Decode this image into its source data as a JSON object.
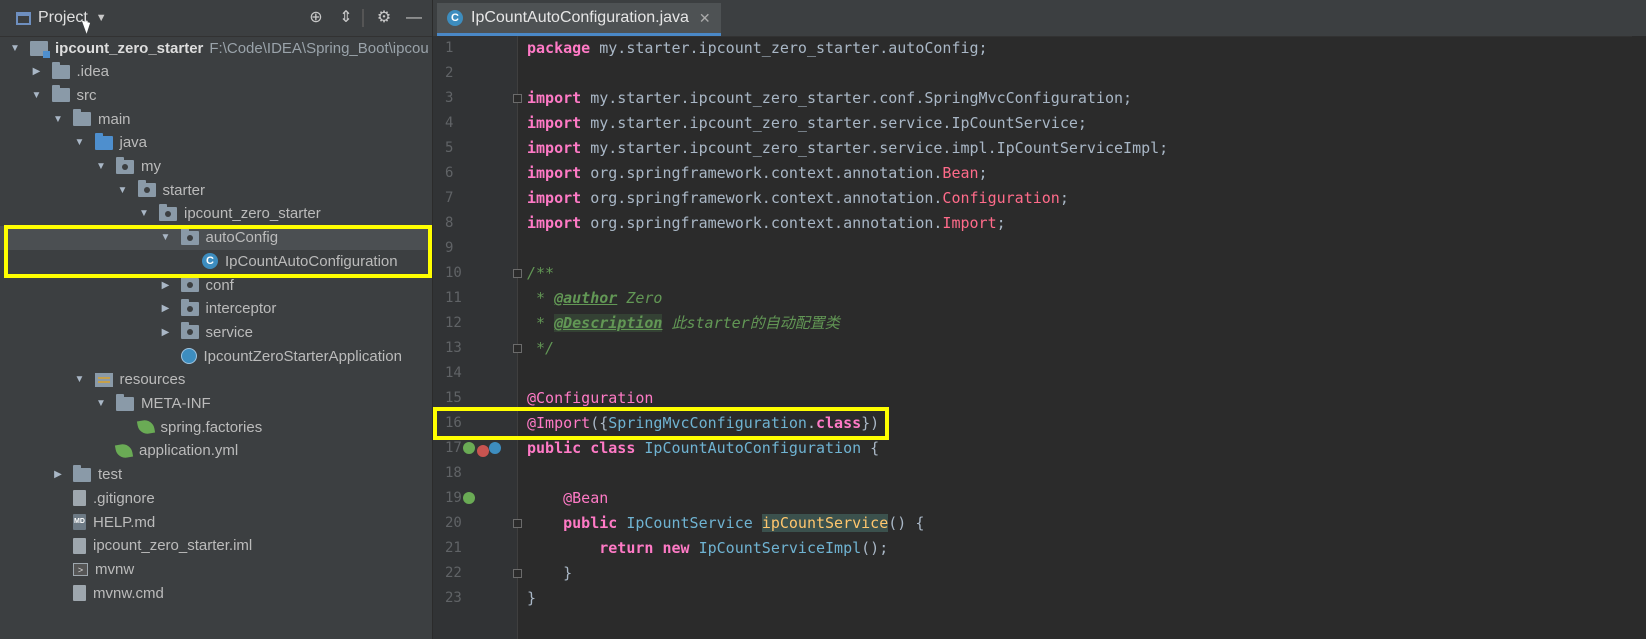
{
  "project": {
    "title": "Project",
    "tree": [
      {
        "label": "ipcount_zero_starter",
        "path": "F:\\Code\\IDEA\\Spring_Boot\\ipcou",
        "icon": "module-icon",
        "arrow": "open",
        "depth": 0,
        "bold": true
      },
      {
        "label": ".idea",
        "icon": "folder-icon",
        "arrow": "closed",
        "depth": 1
      },
      {
        "label": "src",
        "icon": "folder-icon",
        "arrow": "open",
        "depth": 1
      },
      {
        "label": "main",
        "icon": "folder-icon",
        "arrow": "open",
        "depth": 2
      },
      {
        "label": "java",
        "icon": "source-folder-icon",
        "arrow": "open",
        "depth": 3
      },
      {
        "label": "my",
        "icon": "package-icon",
        "arrow": "open",
        "depth": 4
      },
      {
        "label": "starter",
        "icon": "package-icon",
        "arrow": "open",
        "depth": 5
      },
      {
        "label": "ipcount_zero_starter",
        "icon": "package-icon",
        "arrow": "open",
        "depth": 6
      },
      {
        "label": "autoConfig",
        "icon": "package-icon",
        "arrow": "open",
        "depth": 7,
        "selected": true
      },
      {
        "label": "IpCountAutoConfiguration",
        "icon": "class-icon",
        "arrow": "none",
        "depth": 8
      },
      {
        "label": "conf",
        "icon": "package-icon",
        "arrow": "closed",
        "depth": 7
      },
      {
        "label": "interceptor",
        "icon": "package-icon",
        "arrow": "closed",
        "depth": 7
      },
      {
        "label": "service",
        "icon": "package-icon",
        "arrow": "closed",
        "depth": 7
      },
      {
        "label": "IpcountZeroStarterApplication",
        "icon": "spring-app-icon",
        "arrow": "none",
        "depth": 7
      },
      {
        "label": "resources",
        "icon": "resources-folder-icon",
        "arrow": "open",
        "depth": 3
      },
      {
        "label": "META-INF",
        "icon": "folder-icon",
        "arrow": "open",
        "depth": 4
      },
      {
        "label": "spring.factories",
        "icon": "spring-leaf-icon",
        "arrow": "none",
        "depth": 5
      },
      {
        "label": "application.yml",
        "icon": "spring-yml-icon",
        "arrow": "none",
        "depth": 4
      },
      {
        "label": "test",
        "icon": "folder-icon",
        "arrow": "closed",
        "depth": 2
      },
      {
        "label": ".gitignore",
        "icon": "file-icon",
        "arrow": "none",
        "depth": 2
      },
      {
        "label": "HELP.md",
        "icon": "markdown-file-icon",
        "arrow": "none",
        "depth": 2
      },
      {
        "label": "ipcount_zero_starter.iml",
        "icon": "file-icon",
        "arrow": "none",
        "depth": 2
      },
      {
        "label": "mvnw",
        "icon": "terminal-file-icon",
        "arrow": "none",
        "depth": 2
      },
      {
        "label": "mvnw.cmd",
        "icon": "file-icon",
        "arrow": "none",
        "depth": 2
      }
    ]
  },
  "editor": {
    "tab_label": "IpCountAutoConfiguration.java",
    "tab_icon_letter": "C",
    "line_numbers": [
      "1",
      "2",
      "3",
      "4",
      "5",
      "6",
      "7",
      "8",
      "9",
      "10",
      "11",
      "12",
      "13",
      "14",
      "15",
      "16",
      "17",
      "18",
      "19",
      "20",
      "21",
      "22",
      "23"
    ],
    "lines": [
      [
        [
          "kw2",
          "package"
        ],
        [
          "t",
          " my.starter.ipcount_zero_starter.autoConfig;"
        ]
      ],
      [],
      [
        [
          "kw2",
          "import"
        ],
        [
          "t",
          " my.starter.ipcount_zero_starter.conf.SpringMvcConfiguration;"
        ]
      ],
      [
        [
          "kw2",
          "import"
        ],
        [
          "t",
          " my.starter.ipcount_zero_starter.service.IpCountService;"
        ]
      ],
      [
        [
          "kw2",
          "import"
        ],
        [
          "t",
          " my.starter.ipcount_zero_starter.service.impl.IpCountServiceImpl;"
        ]
      ],
      [
        [
          "kw2",
          "import"
        ],
        [
          "t",
          " org.springframework.context.annotation."
        ],
        [
          "ref",
          "Bean"
        ],
        [
          "t",
          ";"
        ]
      ],
      [
        [
          "kw2",
          "import"
        ],
        [
          "t",
          " org.springframework.context.annotation."
        ],
        [
          "ref",
          "Configuration"
        ],
        [
          "t",
          ";"
        ]
      ],
      [
        [
          "kw2",
          "import"
        ],
        [
          "t",
          " org.springframework.context.annotation."
        ],
        [
          "ref",
          "Import"
        ],
        [
          "t",
          ";"
        ]
      ],
      [],
      [
        [
          "cm",
          "/**"
        ]
      ],
      [
        [
          "cm",
          " * "
        ],
        [
          "tag",
          "@author"
        ],
        [
          "cm",
          " Zero"
        ]
      ],
      [
        [
          "cm",
          " * "
        ],
        [
          "tagh",
          "@Description"
        ],
        [
          "cm",
          " 此starter的自动配置类"
        ]
      ],
      [
        [
          "cm",
          " */"
        ]
      ],
      [],
      [
        [
          "annp",
          "@Configuration"
        ]
      ],
      [
        [
          "annp",
          "@Import"
        ],
        [
          "t",
          "({"
        ],
        [
          "tp",
          "SpringMvcConfiguration"
        ],
        [
          "t",
          "."
        ],
        [
          "kw2",
          "class"
        ],
        [
          "t",
          "})"
        ]
      ],
      [
        [
          "kw2",
          "public class"
        ],
        [
          "t",
          " "
        ],
        [
          "tp",
          "IpCountAutoConfiguration"
        ],
        [
          "t",
          " {"
        ]
      ],
      [],
      [
        [
          "t",
          "    "
        ],
        [
          "annp",
          "@Bean"
        ]
      ],
      [
        [
          "t",
          "    "
        ],
        [
          "kw2",
          "public"
        ],
        [
          "t",
          " "
        ],
        [
          "tp",
          "IpCountService"
        ],
        [
          "t",
          " "
        ],
        [
          "mth",
          "ipCountService"
        ],
        [
          "t",
          "() {"
        ]
      ],
      [
        [
          "t",
          "        "
        ],
        [
          "kw2",
          "return new"
        ],
        [
          "t",
          " "
        ],
        [
          "tp",
          "IpCountServiceImpl"
        ],
        [
          "t",
          "();"
        ]
      ],
      [
        [
          "t",
          "    }"
        ]
      ],
      [
        [
          "t",
          "}"
        ]
      ]
    ]
  }
}
